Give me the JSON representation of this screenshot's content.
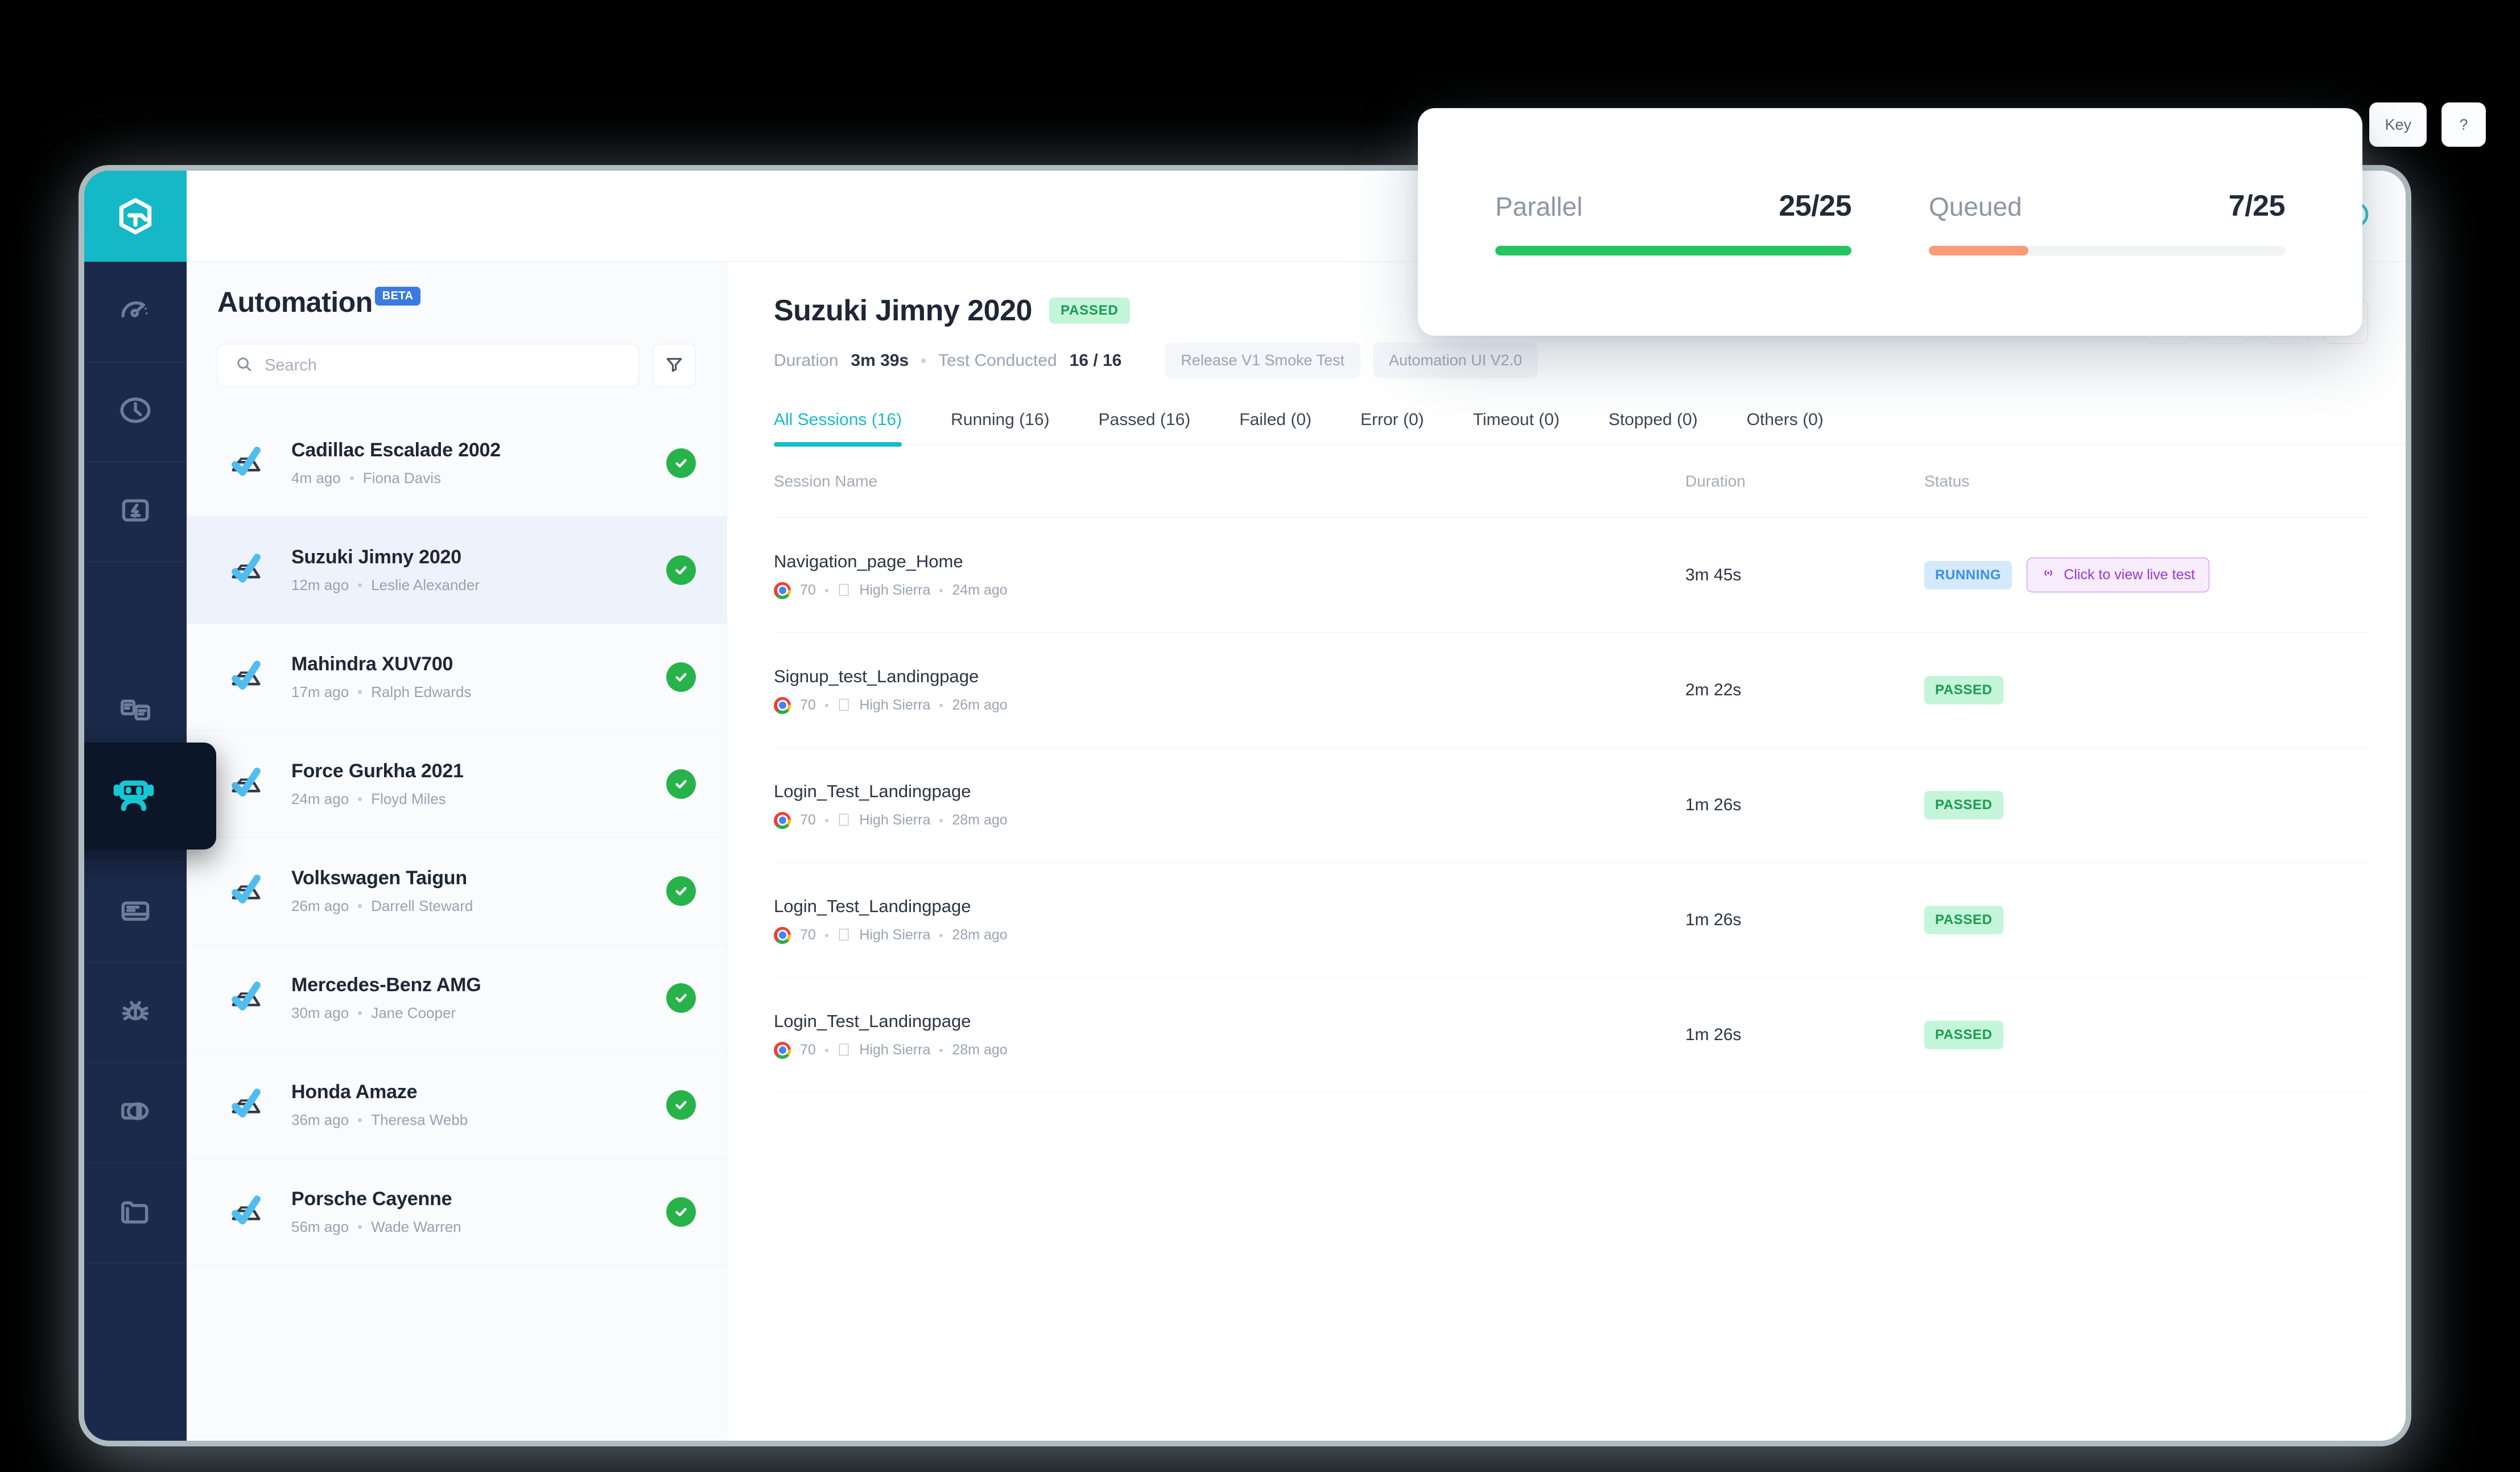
{
  "rail": {
    "logo": "logo-icon",
    "items": [
      {
        "name": "speedometer-icon"
      },
      {
        "name": "clock-icon"
      },
      {
        "name": "lightning-screen-icon"
      },
      {
        "name": "robot-icon",
        "active": true
      },
      {
        "name": "documents-icon"
      },
      {
        "name": "eye-scan-icon"
      },
      {
        "name": "card-text-icon"
      },
      {
        "name": "bug-icon"
      },
      {
        "name": "split-compare-icon"
      },
      {
        "name": "folder-icon"
      }
    ]
  },
  "topbar": {
    "notification_icon": "bell-icon",
    "avatar_icon": "user-avatar-icon",
    "access_key_label": "Key",
    "help_label": "?"
  },
  "stats_card": {
    "items": [
      {
        "label": "Parallel",
        "value": "25/25",
        "percent": 100,
        "color": "#22c55e"
      },
      {
        "label": "Queued",
        "value": "7/25",
        "percent": 28,
        "color": "#fb9b77"
      }
    ]
  },
  "list_panel": {
    "title": "Automation",
    "badge": "BETA",
    "search_placeholder": "Search",
    "search_value": "",
    "filter_icon": "filter-icon",
    "items": [
      {
        "name": "Cadillac Escalade 2002",
        "time": "4m ago",
        "user": "Fiona Davis",
        "status": "passed",
        "selected": false
      },
      {
        "name": "Suzuki Jimny 2020",
        "time": "12m ago",
        "user": "Leslie Alexander",
        "status": "passed",
        "selected": true
      },
      {
        "name": "Mahindra XUV700",
        "time": "17m ago",
        "user": "Ralph Edwards",
        "status": "passed",
        "selected": false
      },
      {
        "name": "Force Gurkha 2021",
        "time": "24m ago",
        "user": "Floyd Miles",
        "status": "passed",
        "selected": false
      },
      {
        "name": "Volkswagen Taigun",
        "time": "26m ago",
        "user": "Darrell Steward",
        "status": "passed",
        "selected": false
      },
      {
        "name": "Mercedes-Benz AMG",
        "time": "30m ago",
        "user": "Jane Cooper",
        "status": "passed",
        "selected": false
      },
      {
        "name": "Honda Amaze",
        "time": "36m ago",
        "user": "Theresa Webb",
        "status": "passed",
        "selected": false
      },
      {
        "name": "Porsche Cayenne",
        "time": "56m ago",
        "user": "Wade Warren",
        "status": "passed",
        "selected": false
      }
    ]
  },
  "main": {
    "title": "Suzuki Jimny 2020",
    "status_badge": "PASSED",
    "duration_label": "Duration",
    "duration_value": "3m 39s",
    "conducted_label": "Test Conducted",
    "conducted_value": "16 / 16",
    "tags": [
      "Release V1 Smoke Test",
      "Automation UI V2.0"
    ],
    "actions": [
      {
        "name": "bug-icon"
      },
      {
        "name": "download-icon"
      },
      {
        "name": "share-icon"
      },
      {
        "name": "trash-icon"
      }
    ],
    "tabs": [
      {
        "label": "All Sessions (16)",
        "active": true
      },
      {
        "label": "Running (16)",
        "active": false
      },
      {
        "label": "Passed (16)",
        "active": false
      },
      {
        "label": "Failed (0)",
        "active": false
      },
      {
        "label": "Error (0)",
        "active": false
      },
      {
        "label": "Timeout (0)",
        "active": false
      },
      {
        "label": "Stopped (0)",
        "active": false
      },
      {
        "label": "Others (0)",
        "active": false
      }
    ],
    "table": {
      "columns": [
        "Session Name",
        "Duration",
        "Status"
      ],
      "rows": [
        {
          "session": "Navigation_page_Home",
          "browser_version": "70",
          "os": "High Sierra",
          "time": "24m ago",
          "duration": "3m 45s",
          "status": "RUNNING",
          "status_kind": "running",
          "live_label": "Click to view live test"
        },
        {
          "session": "Signup_test_Landingpage",
          "browser_version": "70",
          "os": "High Sierra",
          "time": "26m ago",
          "duration": "2m 22s",
          "status": "PASSED",
          "status_kind": "passed",
          "live_label": ""
        },
        {
          "session": "Login_Test_Landingpage",
          "browser_version": "70",
          "os": "High Sierra",
          "time": "28m ago",
          "duration": "1m 26s",
          "status": "PASSED",
          "status_kind": "passed",
          "live_label": ""
        },
        {
          "session": "Login_Test_Landingpage",
          "browser_version": "70",
          "os": "High Sierra",
          "time": "28m ago",
          "duration": "1m 26s",
          "status": "PASSED",
          "status_kind": "passed",
          "live_label": ""
        },
        {
          "session": "Login_Test_Landingpage",
          "browser_version": "70",
          "os": "High Sierra",
          "time": "28m ago",
          "duration": "1m 26s",
          "status": "PASSED",
          "status_kind": "passed",
          "live_label": ""
        }
      ]
    }
  },
  "colors": {
    "brand_teal": "#17bcc9",
    "rail_navy": "#1b2a4a",
    "active_navy": "#0b1628",
    "green": "#27b34a",
    "badge_blue": "#3b7ae0",
    "purple": "#9b35d8",
    "danger": "#ef6a73"
  }
}
